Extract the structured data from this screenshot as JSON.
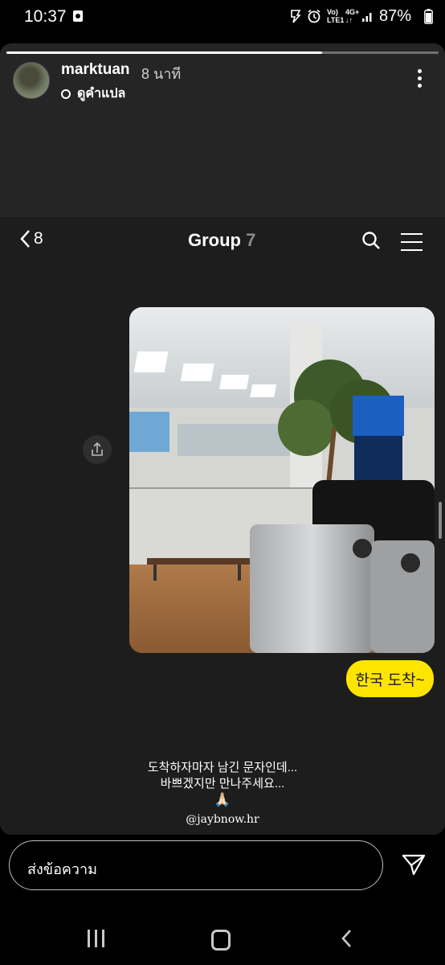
{
  "status_bar": {
    "time": "10:37",
    "network_label_top": "Vo)",
    "network_label_bottom": "LTE1",
    "network_type": "4G+",
    "battery": "87%"
  },
  "story": {
    "progress": 0.73,
    "username": "marktuan",
    "time_ago": "8 นาที",
    "translate_label": "ดูคำแปล"
  },
  "chat": {
    "back_count": "8",
    "group_title": "Group",
    "group_count": "7",
    "bubble_text": "한국 도착~"
  },
  "caption": {
    "line1": "도착하자마자 남긴 문자인데...",
    "line2": "바쁘겠지만 만나주세요...",
    "emoji": "🙏🏻",
    "handle": "@jaybnow.hr"
  },
  "reply": {
    "placeholder": "ส่งข้อความ"
  },
  "icons": {
    "back": "chevron-left-icon",
    "search": "search-icon",
    "menu": "menu-icon",
    "share": "share-icon",
    "send": "send-icon",
    "more": "more-vertical-icon"
  },
  "colors": {
    "bubble": "#fde500",
    "background": "#252525"
  }
}
